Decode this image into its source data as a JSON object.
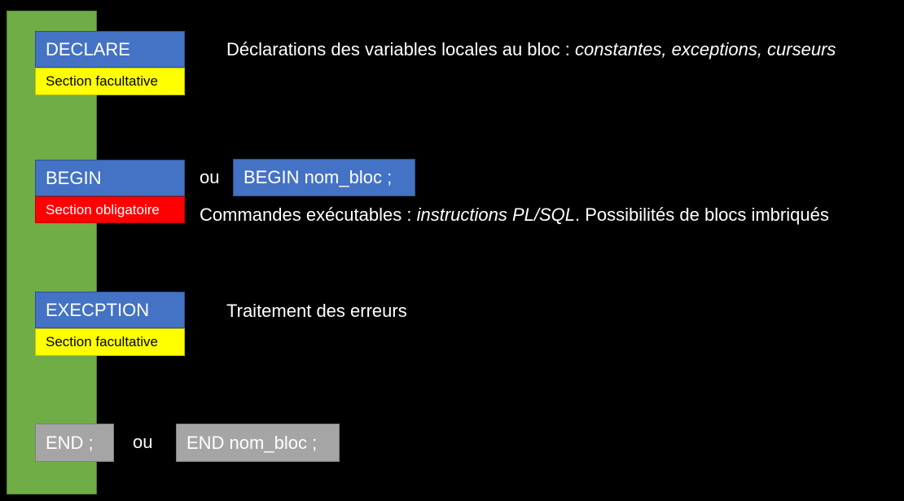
{
  "colors": {
    "background": "#000000",
    "block_bar": "#70ad47",
    "keyword_box": "#4472c4",
    "end_box": "#a5a5a5",
    "optional_tag": "#ffff00",
    "mandatory_tag": "#ff0000"
  },
  "declare": {
    "keyword": "DECLARE",
    "tag": "Section facultative",
    "description_plain": "Déclarations des variables locales au bloc : ",
    "description_italic": "constantes, exceptions, curseurs"
  },
  "begin": {
    "keyword": "BEGIN",
    "tag": "Section obligatoire",
    "or_label": "ou",
    "alt_keyword": "BEGIN nom_bloc ;",
    "description_plain_1": "Commandes exécutables : ",
    "description_italic": "instructions PL/SQL",
    "description_plain_2": ". Possibilités de blocs imbriqués"
  },
  "exception": {
    "keyword": "EXECPTION",
    "tag": "Section facultative",
    "description": "Traitement des erreurs"
  },
  "end": {
    "keyword": "END ;",
    "or_label": "ou",
    "alt_keyword": "END nom_bloc ;"
  }
}
